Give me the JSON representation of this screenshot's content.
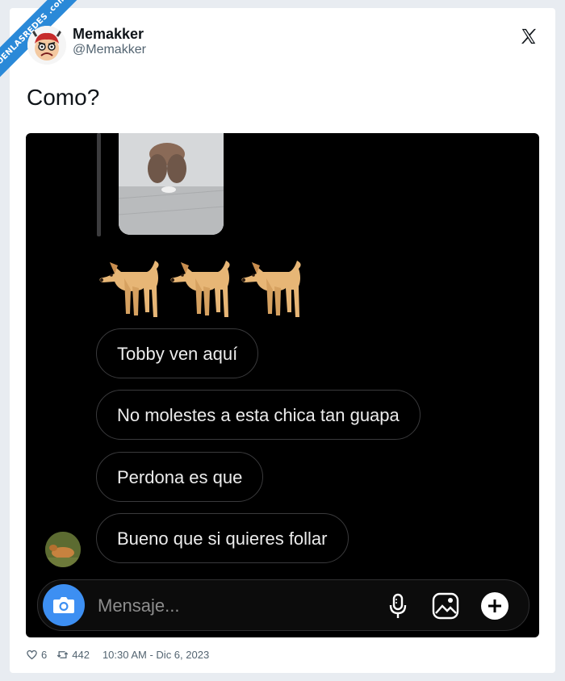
{
  "watermark": "VISTOENLASREDES .com",
  "author": {
    "name": "Memakker",
    "handle": "@Memakker"
  },
  "tweet": {
    "text": "Como?"
  },
  "chat": {
    "messages": [
      "Tobby ven aquí",
      "No molestes a esta chica tan guapa",
      "Perdona es que",
      "Bueno que si quieres follar"
    ],
    "composer_placeholder": "Mensaje..."
  },
  "footer": {
    "likes": "6",
    "retweets": "442",
    "timestamp": "10:30 AM - Dic 6, 2023"
  },
  "colors": {
    "accent": "#3d8ff2",
    "watermark": "#2a89d8"
  }
}
